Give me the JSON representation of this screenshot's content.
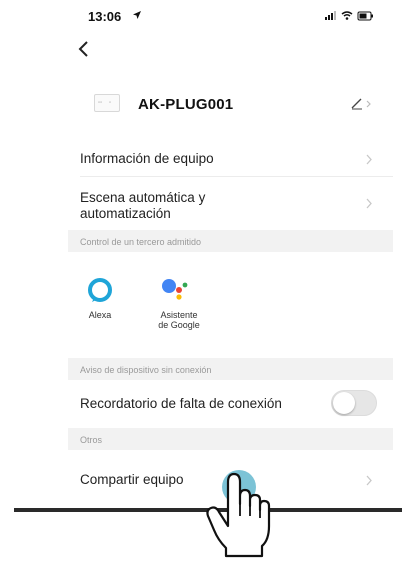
{
  "status_bar": {
    "time": "13:06"
  },
  "device": {
    "name": "AK-PLUG001",
    "icon_text": "⁝ʼ˖ǀ"
  },
  "rows": {
    "device_info": "Información de equipo",
    "auto_scene": "Escena automática y\nautomatización"
  },
  "third_party": {
    "header": "Control de un tercero admitido",
    "services": [
      {
        "name": "Alexa"
      },
      {
        "name": "Asistente\nde Google"
      }
    ]
  },
  "offline": {
    "header": "Aviso de dispositivo sin conexión",
    "reminder_label": "Recordatorio de falta de conexión",
    "reminder_enabled": false
  },
  "others": {
    "header": "Otros",
    "share_label": "Compartir equipo"
  },
  "colors": {
    "accent_tap": "#50afc8",
    "alexa": "#1fa5d8"
  },
  "icons": [
    "location-arrow-icon",
    "signal-icon",
    "wifi-icon",
    "battery-icon",
    "back-chevron-icon",
    "device-plug-icon",
    "edit-pencil-icon",
    "chevron-right-icon",
    "alexa-icon",
    "google-assistant-icon",
    "hand-pointer-icon"
  ]
}
